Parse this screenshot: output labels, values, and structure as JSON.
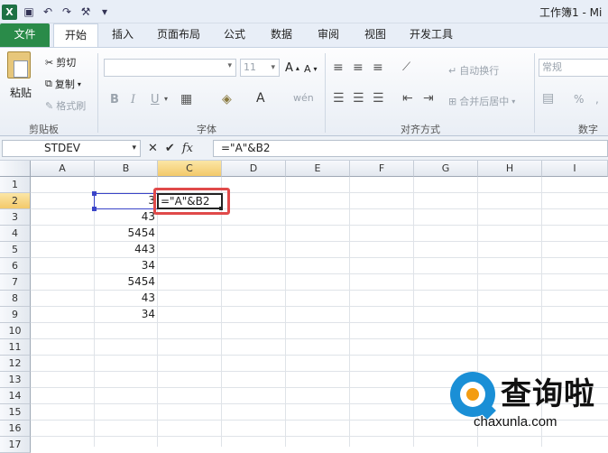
{
  "window": {
    "title": "工作簿1 - Mi"
  },
  "qat": {
    "app_icon": "X"
  },
  "tabs": {
    "file": "文件",
    "items": [
      "开始",
      "插入",
      "页面布局",
      "公式",
      "数据",
      "审阅",
      "视图",
      "开发工具"
    ]
  },
  "ribbon": {
    "clipboard": {
      "label": "剪贴板",
      "paste": "粘贴",
      "cut": "剪切",
      "copy": "复制",
      "format_painter": "格式刷"
    },
    "font": {
      "label": "字体",
      "size": "11",
      "bold": "B",
      "italic": "I",
      "underline": "U",
      "grow": "A",
      "shrink": "A",
      "phonetic": "wén"
    },
    "alignment": {
      "label": "对齐方式",
      "wrap": "自动换行",
      "merge": "合并后居中"
    },
    "number": {
      "label": "数字",
      "format": "常规",
      "percent": "%"
    }
  },
  "formula_bar": {
    "name_box": "STDEV",
    "fx": "fx",
    "formula": "=\"A\"&B2"
  },
  "sheet": {
    "columns": [
      "A",
      "B",
      "C",
      "D",
      "E",
      "F",
      "G",
      "H",
      "I"
    ],
    "rows": [
      "1",
      "2",
      "3",
      "4",
      "5",
      "6",
      "7",
      "8",
      "9",
      "10",
      "11",
      "12",
      "13",
      "14",
      "15",
      "16",
      "17"
    ],
    "b_values": [
      "3",
      "43",
      "5454",
      "443",
      "34",
      "5454",
      "43",
      "34"
    ],
    "editing_cell": "=\"A\"&B2"
  },
  "watermark": {
    "cn": "查询啦",
    "en": "chaxunla.com"
  }
}
